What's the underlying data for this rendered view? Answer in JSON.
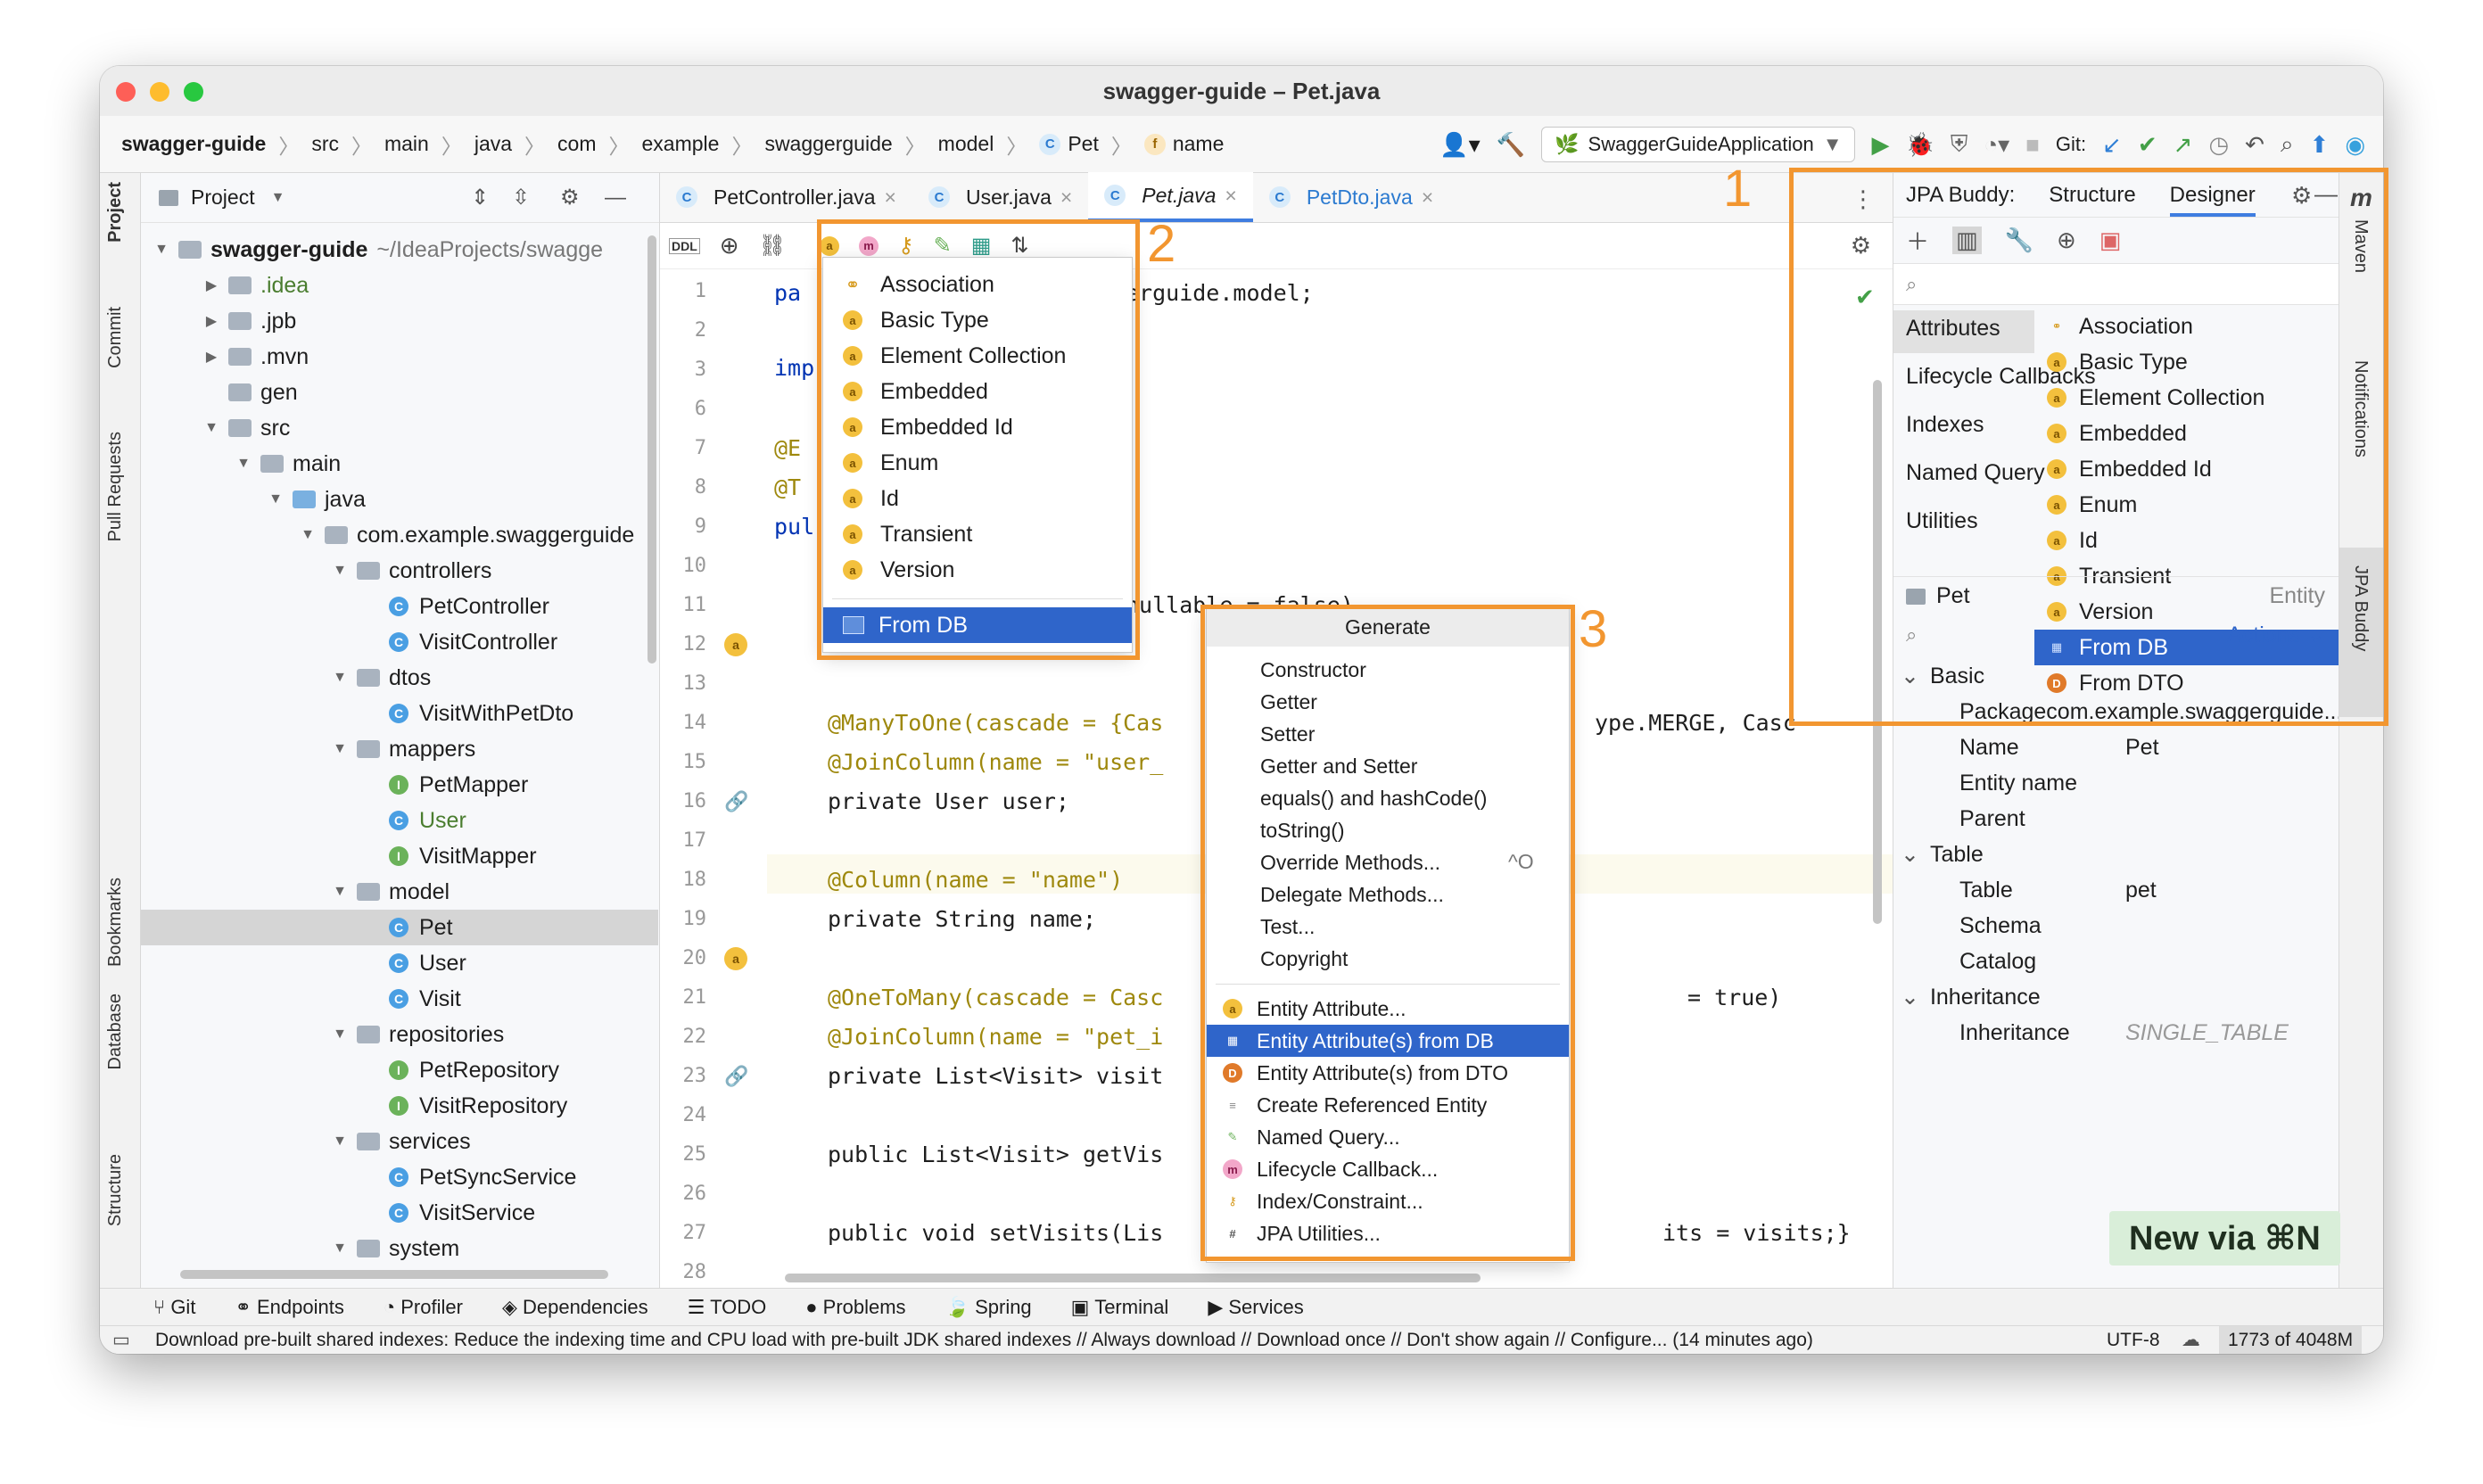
{
  "window": {
    "title": "swagger-guide – Pet.java"
  },
  "breadcrumb": [
    "swagger-guide",
    "src",
    "main",
    "java",
    "com",
    "example",
    "swaggerguide",
    "model",
    "Pet",
    "name"
  ],
  "run_config": "SwaggerGuideApplication",
  "git_label": "Git:",
  "left_strip": [
    "Project",
    "Commit",
    "Pull Requests",
    "Bookmarks",
    "Database",
    "Structure"
  ],
  "project_panel": {
    "title": "Project",
    "root": "swagger-guide",
    "root_path": "~/IdeaProjects/swagge",
    "tree": [
      {
        "label": ".idea",
        "kind": "folder",
        "level": 1,
        "color": "#4a7d2f"
      },
      {
        "label": ".jpb",
        "kind": "folder",
        "level": 1
      },
      {
        "label": ".mvn",
        "kind": "folder",
        "level": 1
      },
      {
        "label": "gen",
        "kind": "folder",
        "level": 1
      },
      {
        "label": "src",
        "kind": "folder",
        "level": 1
      },
      {
        "label": "main",
        "kind": "folder",
        "level": 2
      },
      {
        "label": "java",
        "kind": "folder",
        "level": 3
      },
      {
        "label": "com.example.swaggerguide",
        "kind": "folder",
        "level": 4
      },
      {
        "label": "controllers",
        "kind": "folder",
        "level": 5
      },
      {
        "label": "PetController",
        "kind": "class",
        "level": 6
      },
      {
        "label": "VisitController",
        "kind": "class",
        "level": 6
      },
      {
        "label": "dtos",
        "kind": "folder",
        "level": 5
      },
      {
        "label": "VisitWithPetDto",
        "kind": "class",
        "level": 6
      },
      {
        "label": "mappers",
        "kind": "folder",
        "level": 5
      },
      {
        "label": "PetMapper",
        "kind": "interface",
        "level": 6
      },
      {
        "label": "User",
        "kind": "class",
        "level": 6,
        "color": "#4a7d2f"
      },
      {
        "label": "VisitMapper",
        "kind": "interface",
        "level": 6
      },
      {
        "label": "model",
        "kind": "folder",
        "level": 5
      },
      {
        "label": "Pet",
        "kind": "class",
        "level": 6,
        "selected": true
      },
      {
        "label": "User",
        "kind": "class",
        "level": 6
      },
      {
        "label": "Visit",
        "kind": "class",
        "level": 6
      },
      {
        "label": "repositories",
        "kind": "folder",
        "level": 5
      },
      {
        "label": "PetRepository",
        "kind": "interface",
        "level": 6
      },
      {
        "label": "VisitRepository",
        "kind": "interface",
        "level": 6
      },
      {
        "label": "services",
        "kind": "folder",
        "level": 5
      },
      {
        "label": "PetSyncService",
        "kind": "class",
        "level": 6
      },
      {
        "label": "VisitService",
        "kind": "class",
        "level": 6
      },
      {
        "label": "system",
        "kind": "folder",
        "level": 5
      }
    ]
  },
  "editor": {
    "tabs": [
      "PetController.java",
      "User.java",
      "Pet.java",
      "PetDto.java"
    ],
    "active_tab": "Pet.java",
    "line_numbers": [
      "1",
      "2",
      "3",
      "6",
      "7",
      "8",
      "9",
      "10",
      "11",
      "12",
      "13",
      "14",
      "15",
      "16",
      "17",
      "18",
      "19",
      "20",
      "21",
      "22",
      "23",
      "24",
      "25",
      "26",
      "27",
      "28"
    ],
    "lines": {
      "l1a": "pa",
      "l1b": "erguide.model;",
      "l3": "imp",
      "l7": "@E",
      "l8": "@T",
      "l9": "pul",
      "l11": "nullable = false)",
      "l14a": "@ManyToOne(cascade = {Cas",
      "l14b": "ype.MERGE, Casc",
      "l15a": "@JoinColumn(name = \"user_",
      "l16": "private User user;",
      "l18a": "@Column(name = \"name\")",
      "l19": "private String name;",
      "l21a": "@OneToMany(cascade = Casc",
      "l21b": "= true)",
      "l22a": "@JoinColumn(name = \"pet_i",
      "l23": "private List<Visit> visit",
      "l25": "public List<Visit> getVis",
      "l27a": "public void setVisits(Lis",
      "l27b": "its = visits;}"
    }
  },
  "popup_attr": {
    "items": [
      "Association",
      "Basic Type",
      "Element Collection",
      "Embedded",
      "Embedded Id",
      "Enum",
      "Id",
      "Transient",
      "Version"
    ],
    "selected": "From DB"
  },
  "popup_generate": {
    "title": "Generate",
    "items": [
      "Constructor",
      "Getter",
      "Setter",
      "Getter and Setter",
      "equals() and hashCode()",
      "toString()",
      "Override Methods...",
      "Delegate Methods...",
      "Test...",
      "Copyright"
    ],
    "override_shortcut": "^O",
    "jpa_items": [
      "Entity Attribute...",
      "Entity Attribute(s) from DB",
      "Entity Attribute(s) from DTO",
      "Create Referenced Entity",
      "Named Query...",
      "Lifecycle Callback...",
      "Index/Constraint...",
      "JPA Utilities..."
    ],
    "selected": "Entity Attribute(s) from DB"
  },
  "callouts": [
    "1",
    "2",
    "3"
  ],
  "jpa_buddy": {
    "title": "JPA Buddy:",
    "tabs": [
      "Structure",
      "Designer"
    ],
    "active_tab": "Designer",
    "categories": [
      "Attributes",
      "Lifecycle Callbacks",
      "Indexes",
      "Named Query",
      "Utilities"
    ],
    "items": [
      "Association",
      "Basic Type",
      "Element Collection",
      "Embedded",
      "Embedded Id",
      "Enum",
      "Id",
      "Transient",
      "Version",
      "From DB",
      "From DTO"
    ],
    "selected": "From DB"
  },
  "inspector": {
    "entity_name": "Pet",
    "entity_kind": "Entity",
    "actions": "Actions",
    "groups": {
      "basic": "Basic",
      "table": "Table",
      "inheritance": "Inheritance"
    },
    "props": {
      "package_k": "Package",
      "package_v": "com.example.swaggerguide...",
      "name_k": "Name",
      "name_v": "Pet",
      "entity_name_k": "Entity name",
      "parent_k": "Parent",
      "table_k": "Table",
      "table_v": "pet",
      "schema_k": "Schema",
      "catalog_k": "Catalog",
      "inheritance_k": "Inheritance",
      "inheritance_v": "SINGLE_TABLE"
    }
  },
  "right_strip": [
    "Maven",
    "Notifications",
    "JPA Buddy"
  ],
  "new_via": "New via ⌘N",
  "bottom_tools": [
    "Git",
    "Endpoints",
    "Profiler",
    "Dependencies",
    "TODO",
    "Problems",
    "Spring",
    "Terminal",
    "Services"
  ],
  "status": {
    "message": "Download pre-built shared indexes: Reduce the indexing time and CPU load with pre-built JDK shared indexes // Always download // Download once // Don't show again // Configure... (14 minutes ago)",
    "encoding": "UTF-8",
    "memory": "1773 of 4048M"
  }
}
